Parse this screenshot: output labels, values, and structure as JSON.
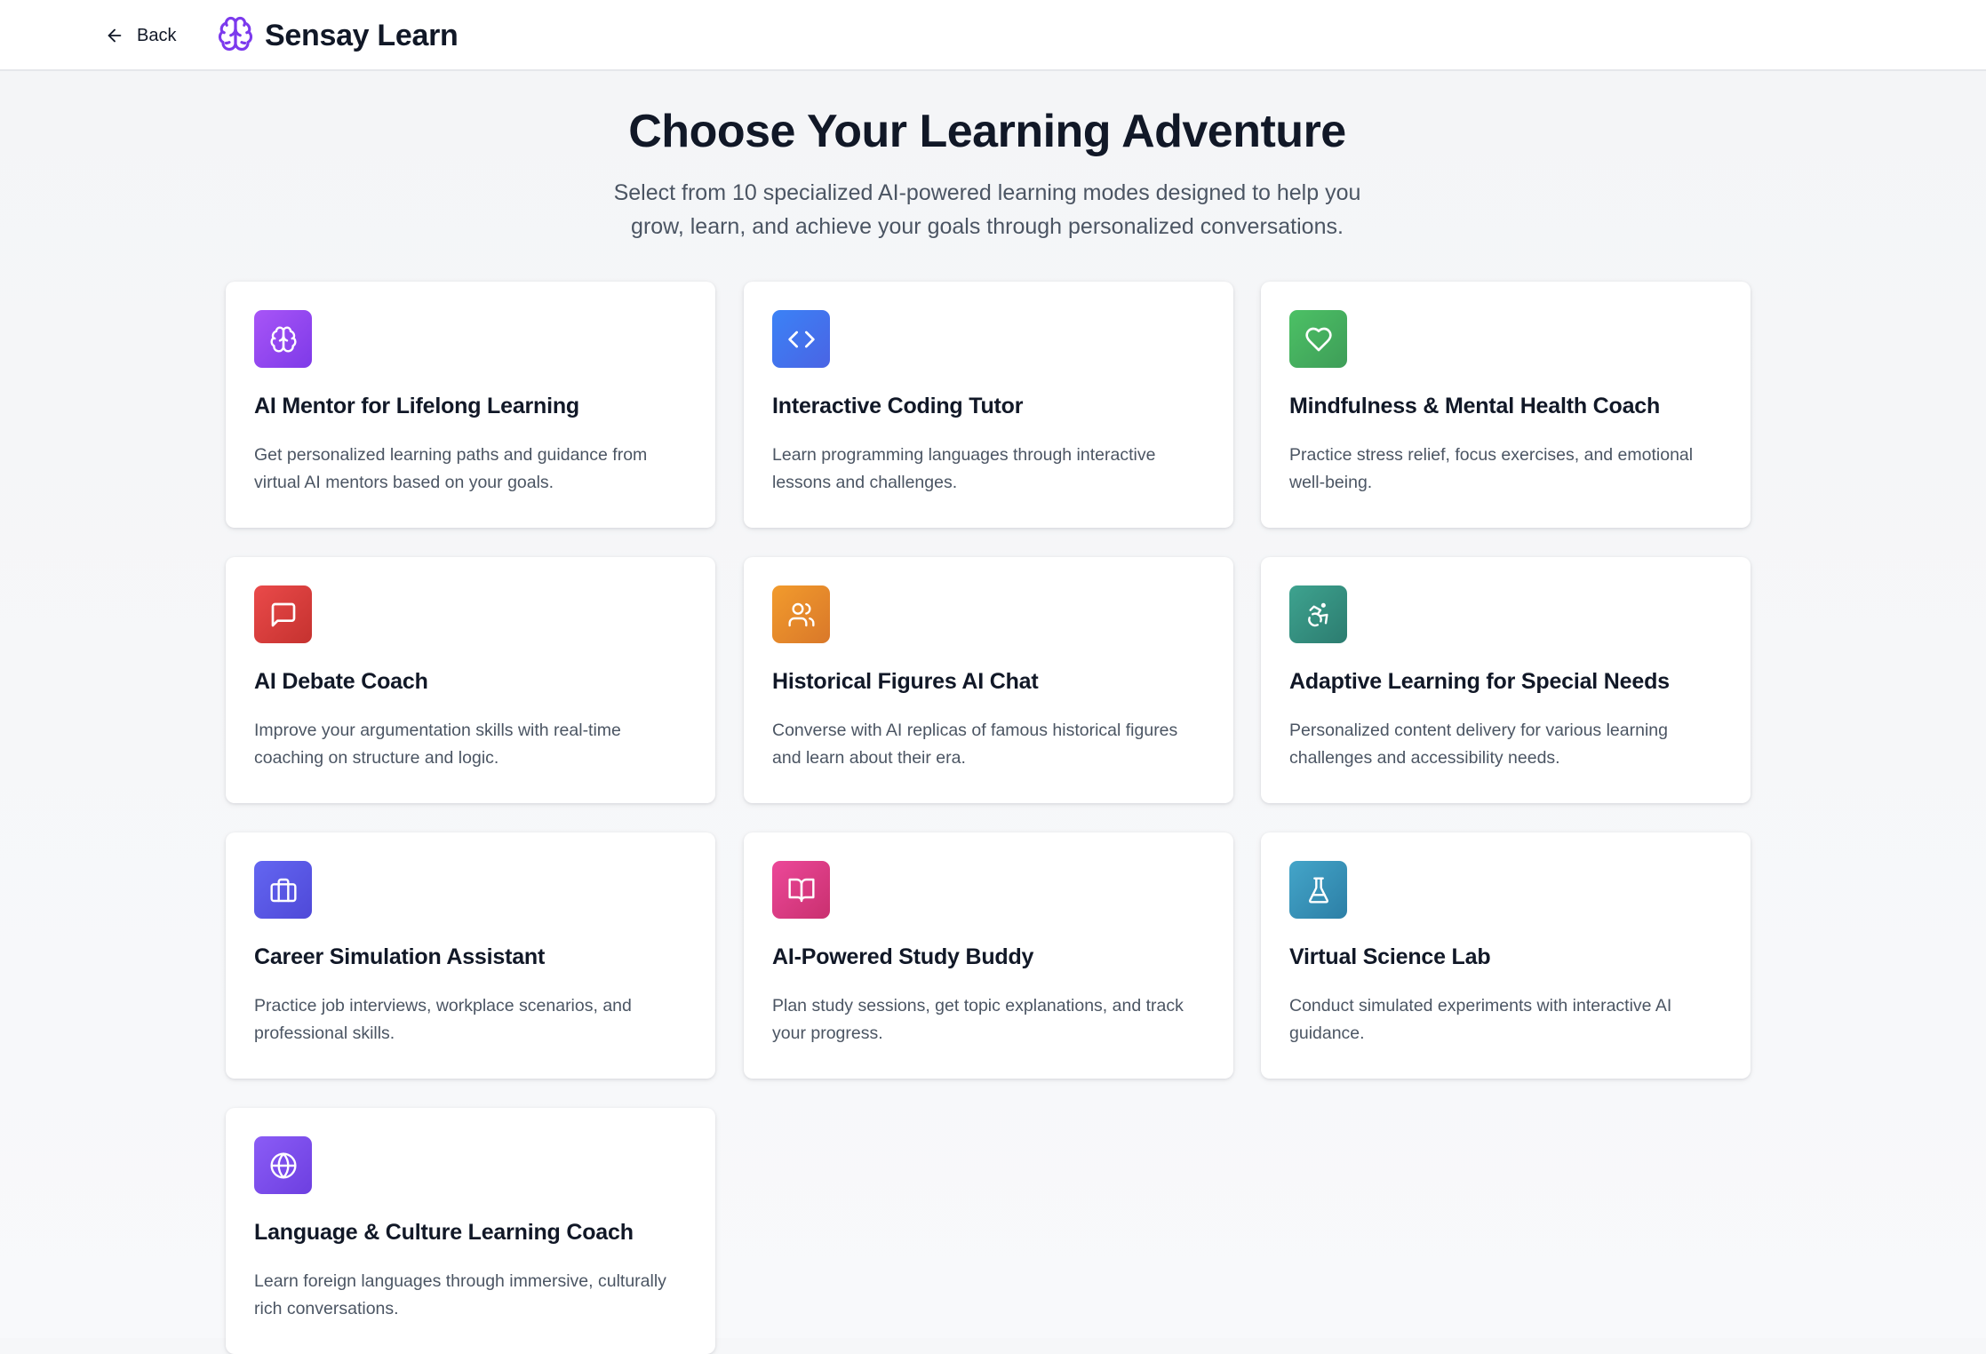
{
  "header": {
    "back_label": "Back",
    "brand_name": "Sensay Learn",
    "brand_icon": "brain-icon",
    "brand_color": "#7c3aed"
  },
  "hero": {
    "title": "Choose Your Learning Adventure",
    "subtitle": "Select from 10 specialized AI-powered learning modes designed to help you grow, learn, and achieve your goals through personalized conversations."
  },
  "modes": [
    {
      "title": "AI Mentor for Lifelong Learning",
      "description": "Get personalized learning paths and guidance from virtual AI mentors based on your goals.",
      "icon": "brain-icon",
      "color": "#9b4ff3"
    },
    {
      "title": "Interactive Coding Tutor",
      "description": "Learn programming languages through interactive lessons and challenges.",
      "icon": "code-icon",
      "color": "#3f74ef"
    },
    {
      "title": "Mindfulness & Mental Health Coach",
      "description": "Practice stress relief, focus exercises, and emotional well-being.",
      "icon": "heart-icon",
      "color": "#46b05f"
    },
    {
      "title": "AI Debate Coach",
      "description": "Improve your argumentation skills with real-time coaching on structure and logic.",
      "icon": "message-square-icon",
      "color": "#dc3f3d"
    },
    {
      "title": "Historical Figures AI Chat",
      "description": "Converse with AI replicas of famous historical figures and learn about their era.",
      "icon": "users-icon",
      "color": "#e88a2b"
    },
    {
      "title": "Adaptive Learning for Special Needs",
      "description": "Personalized content delivery for various learning challenges and accessibility needs.",
      "icon": "accessibility-icon",
      "color": "#36907f"
    },
    {
      "title": "Career Simulation Assistant",
      "description": "Practice job interviews, workplace scenarios, and professional skills.",
      "icon": "briefcase-icon",
      "color": "#5a57e6"
    },
    {
      "title": "AI-Powered Study Buddy",
      "description": "Plan study sessions, get topic explanations, and track your progress.",
      "icon": "book-open-icon",
      "color": "#dc3d86"
    },
    {
      "title": "Virtual Science Lab",
      "description": "Conduct simulated experiments with interactive AI guidance.",
      "icon": "flask-icon",
      "color": "#3993b8"
    },
    {
      "title": "Language & Culture Learning Coach",
      "description": "Learn foreign languages through immersive, culturally rich conversations.",
      "icon": "globe-icon",
      "color": "#7c4deb"
    }
  ]
}
